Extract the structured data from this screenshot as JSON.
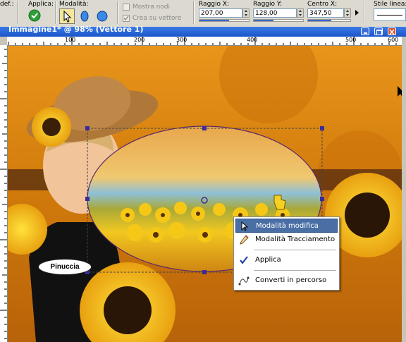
{
  "toolbar": {
    "def_label": "def.:",
    "apply_label": "Applica:",
    "mode_label": "Modalità:",
    "show_nodes_label": "Mostra nodi",
    "create_vector_label": "Crea su vettore",
    "raggio_x_label": "Raggio X:",
    "raggio_x_value": "207,00",
    "raggio_y_label": "Raggio Y:",
    "raggio_y_value": "128,00",
    "centro_x_label": "Centro X:",
    "centro_x_value": "347,50",
    "line_style_label": "Stile linea:"
  },
  "window": {
    "title": "Immagine1* @ 98% (Vettore 1)"
  },
  "ruler": {
    "top_ticks": [
      "100",
      "200",
      "300",
      "400",
      "500",
      "600"
    ]
  },
  "canvas": {
    "badge_text": "Pinuccia"
  },
  "context_menu": {
    "items": [
      {
        "label": "Modalità modifica",
        "icon": "arrow-cursor-icon",
        "highlighted": true
      },
      {
        "label": "Modalità Tracciamento",
        "icon": "pencil-icon",
        "highlighted": false
      },
      {
        "label": "Applica",
        "icon": "checkmark-icon",
        "highlighted": false
      },
      {
        "label": "Converti in percorso",
        "icon": "path-icon",
        "highlighted": false
      }
    ]
  },
  "colors": {
    "accent": "#1a55c8",
    "canvas_orange": "#d08010",
    "menu_highlight": "#4a6fa5"
  }
}
